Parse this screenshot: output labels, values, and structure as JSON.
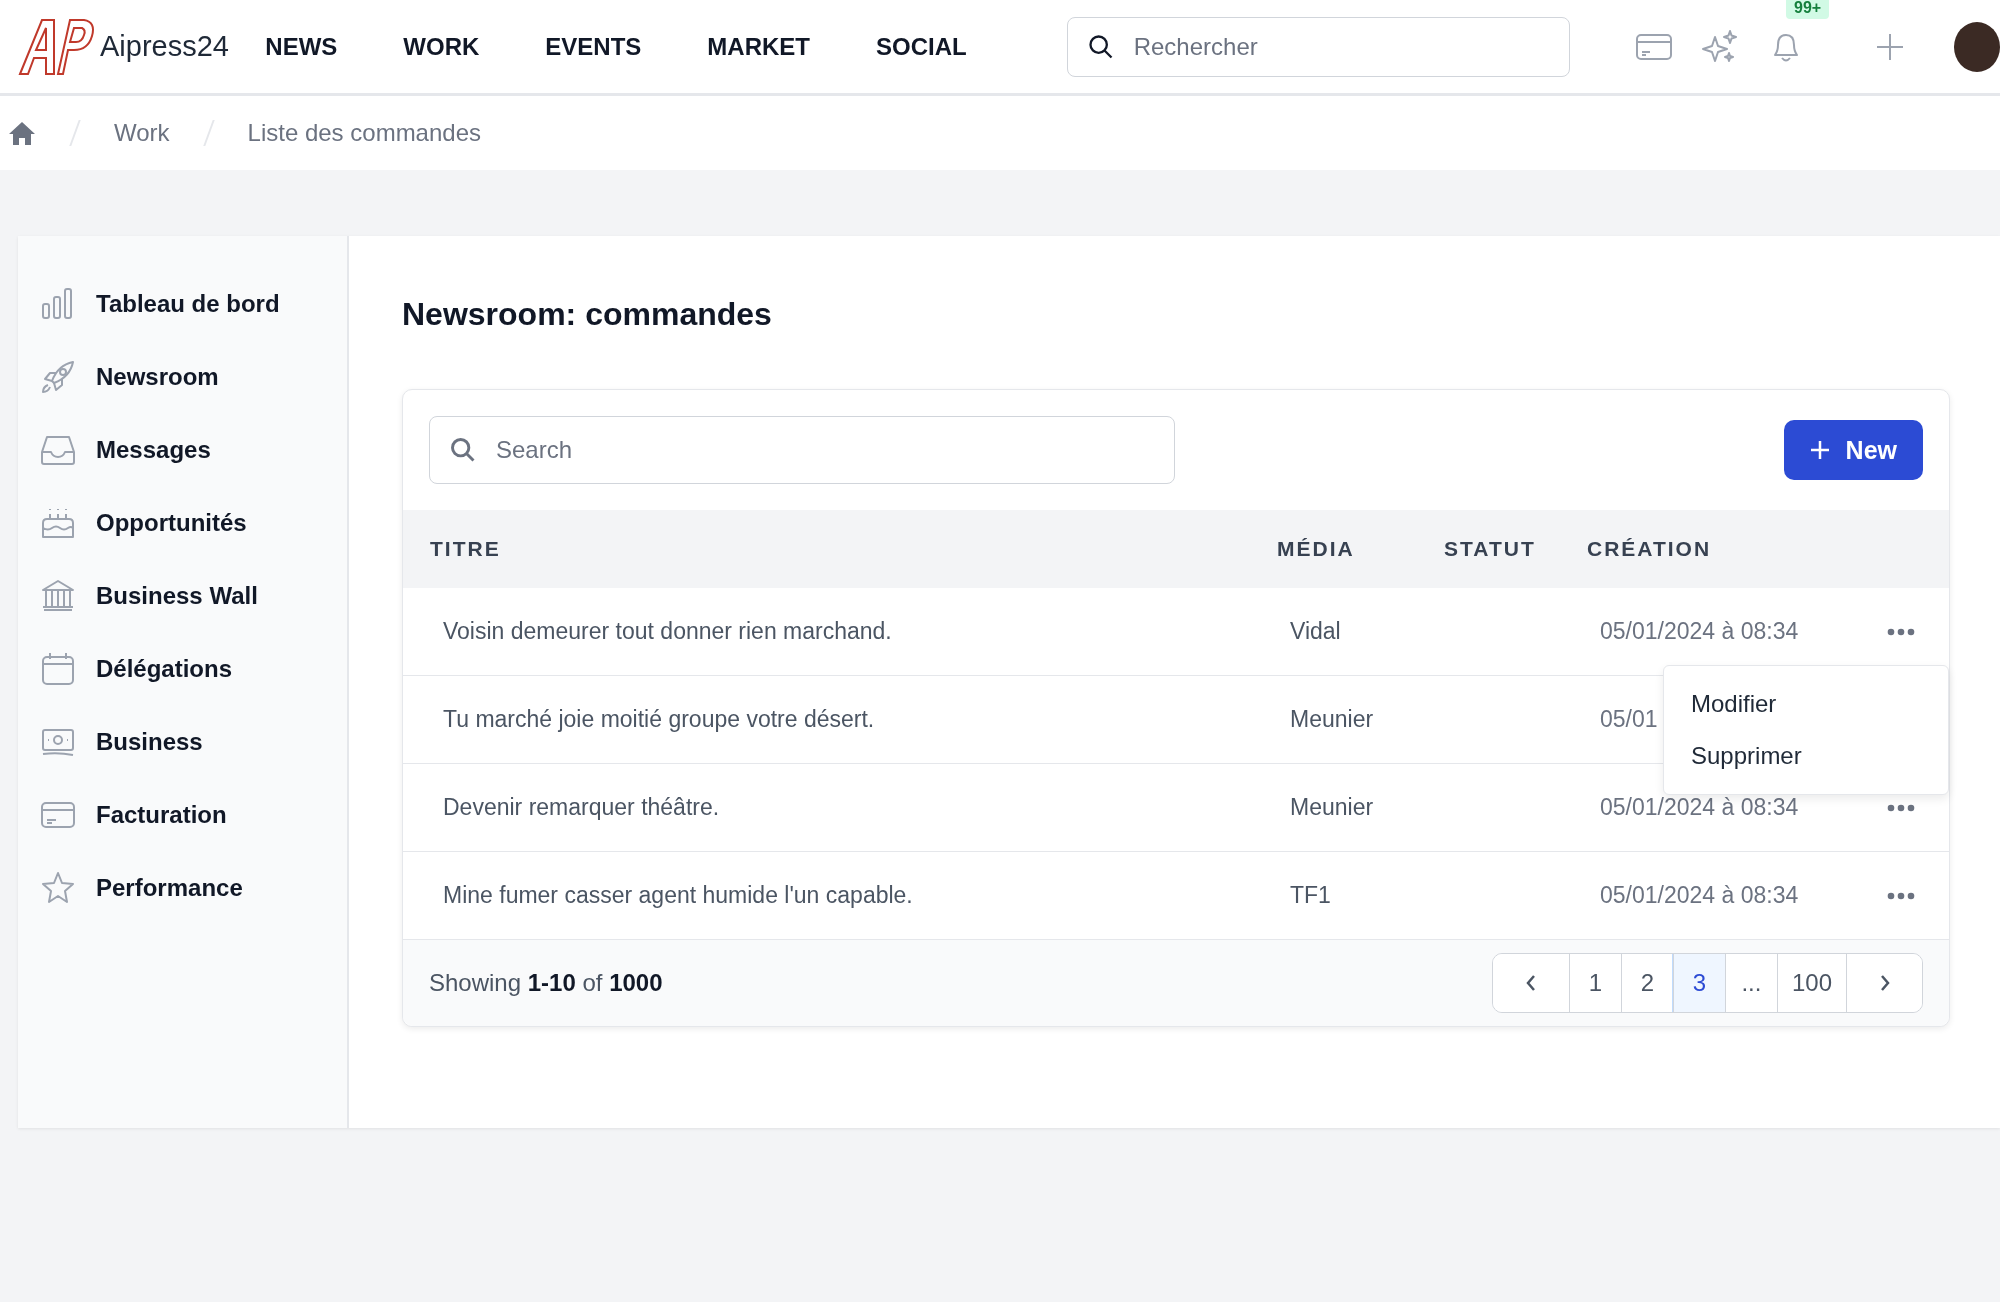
{
  "brand": {
    "name": "Aipress24"
  },
  "nav": [
    {
      "label": "NEWS"
    },
    {
      "label": "WORK"
    },
    {
      "label": "EVENTS"
    },
    {
      "label": "MARKET"
    },
    {
      "label": "SOCIAL"
    }
  ],
  "top_search": {
    "placeholder": "Rechercher"
  },
  "notifications": {
    "badge": "99+"
  },
  "breadcrumb": [
    "Work",
    "Liste des commandes"
  ],
  "sidebar": {
    "items": [
      {
        "label": "Tableau de bord"
      },
      {
        "label": "Newsroom"
      },
      {
        "label": "Messages"
      },
      {
        "label": "Opportunités"
      },
      {
        "label": "Business Wall"
      },
      {
        "label": "Délégations"
      },
      {
        "label": "Business"
      },
      {
        "label": "Facturation"
      },
      {
        "label": "Performance"
      }
    ]
  },
  "page_title": "Newsroom: commandes",
  "table_search": {
    "placeholder": "Search"
  },
  "new_button": {
    "label": "New"
  },
  "table": {
    "columns": [
      "TITRE",
      "MÉDIA",
      "STATUT",
      "CRÉATION"
    ],
    "rows": [
      {
        "titre": "Voisin demeurer tout donner rien marchand.",
        "media": "Vidal",
        "creation": "05/01/2024 à 08:34",
        "menu_open": true
      },
      {
        "titre": "Tu marché joie moitié groupe votre désert.",
        "media": "Meunier",
        "creation": "05/01",
        "menu_open": false
      },
      {
        "titre": "Devenir remarquer théâtre.",
        "media": "Meunier",
        "creation": "05/01/2024 à 08:34",
        "menu_open": false
      },
      {
        "titre": "Mine fumer casser agent humide l'un capable.",
        "media": "TF1",
        "creation": "05/01/2024 à 08:34",
        "menu_open": false
      }
    ]
  },
  "row_menu": [
    "Modifier",
    "Supprimer"
  ],
  "footer": {
    "showing": "Showing **1-10** of **1000**"
  },
  "pagination": [
    {
      "label": "1",
      "selected": false
    },
    {
      "label": "2",
      "selected": false
    },
    {
      "label": "3",
      "selected": true
    },
    {
      "label": "...",
      "selected": false
    },
    {
      "label": "100",
      "selected": false
    }
  ]
}
